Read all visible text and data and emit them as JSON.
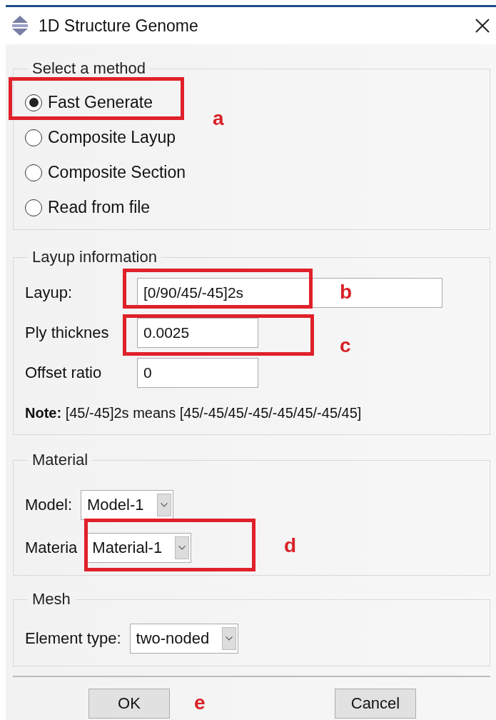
{
  "window": {
    "title": "1D Structure Genome"
  },
  "method_group": {
    "legend": "Select a method",
    "options": [
      {
        "label": "Fast Generate",
        "selected": true
      },
      {
        "label": "Composite Layup",
        "selected": false
      },
      {
        "label": "Composite Section",
        "selected": false
      },
      {
        "label": "Read from file",
        "selected": false
      }
    ]
  },
  "layup_group": {
    "legend": "Layup information",
    "fields": [
      {
        "label": "Layup:",
        "value": "[0/90/45/-45]2s",
        "kind": "wide"
      },
      {
        "label": "Ply thicknes",
        "value": "0.0025",
        "kind": "short"
      },
      {
        "label": "Offset ratio",
        "value": "0",
        "kind": "short"
      }
    ],
    "note": "**Note:**  [45/-45]2s means [45/-45/45/-45/-45/45/-45/45]"
  },
  "material_group": {
    "legend": "Material",
    "selects": [
      {
        "label": "Model:",
        "value": "Model-1"
      },
      {
        "label": "Materia",
        "value": "Material-1"
      }
    ]
  },
  "mesh_group": {
    "legend": "Mesh",
    "selects": [
      {
        "label": "Element type:",
        "value": "two-noded"
      }
    ]
  },
  "buttons": [
    "OK",
    "Cancel"
  ],
  "annotations": [
    {
      "letter": "a"
    },
    {
      "letter": "b"
    },
    {
      "letter": "c"
    },
    {
      "letter": "d"
    },
    {
      "letter": "e"
    }
  ]
}
